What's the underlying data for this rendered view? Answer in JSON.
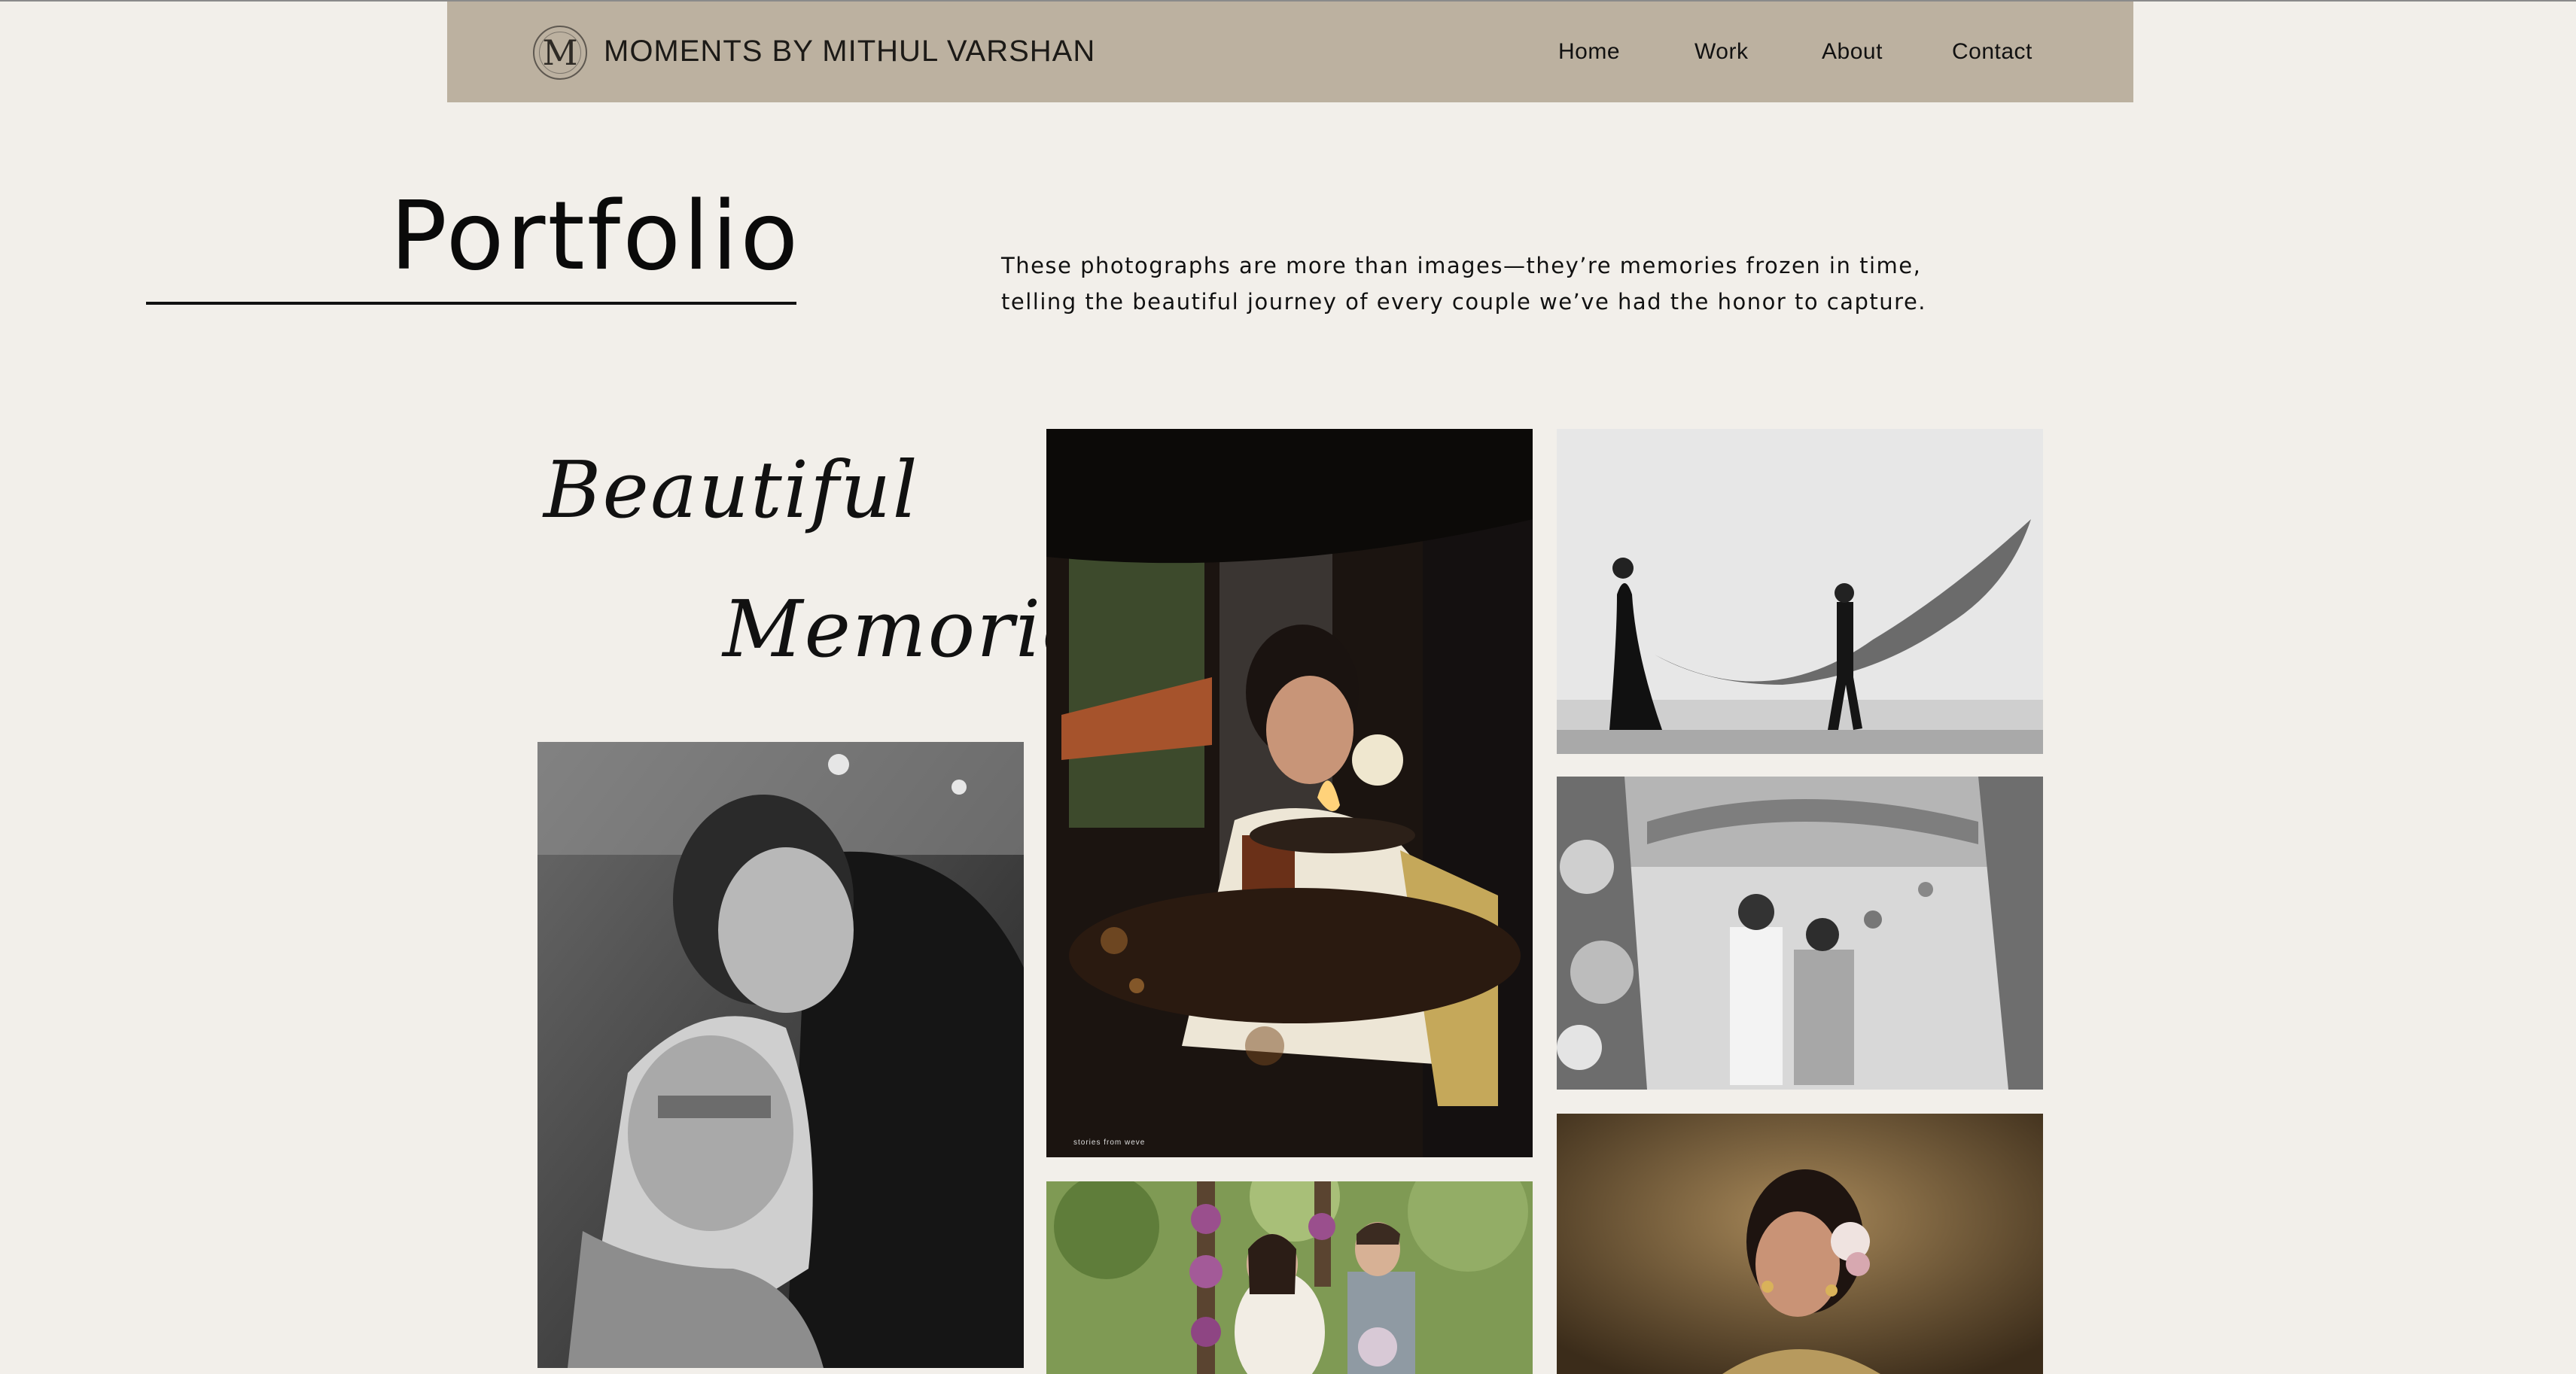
{
  "brand": {
    "logo_letter": "M",
    "name": "MOMENTS BY MITHUL VARSHAN"
  },
  "nav": {
    "items": [
      "Home",
      "Work",
      "About",
      "Contact"
    ]
  },
  "page": {
    "title": "Portfolio",
    "intro_line1": "These photographs are more than images—they’re memories frozen in time,",
    "intro_line2": "telling the beautiful journey of every couple we’ve had the honor to capture."
  },
  "tagline": {
    "word1": "Beautiful",
    "word2": "Memories"
  },
  "photos": {
    "watermark": "stories from weve"
  },
  "colors": {
    "background": "#f2efea",
    "header": "#bcb1a0",
    "text": "#111111"
  }
}
